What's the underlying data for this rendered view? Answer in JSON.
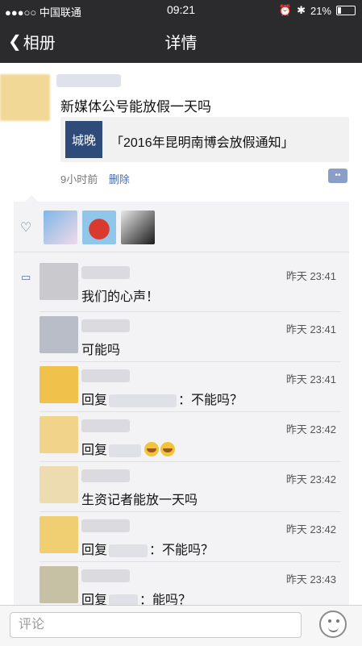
{
  "status": {
    "carrier": "●●●○○ 中国联通",
    "wifi": "wifi-icon",
    "time": "09:21",
    "battery": "21%",
    "battery_icon": "battery-icon"
  },
  "nav": {
    "back": "相册",
    "title": "详情"
  },
  "post": {
    "text": "新媒体公号能放假一天吗",
    "share_title": "「2016年昆明南博会放假通知」",
    "thumb_text": "城晚",
    "time": "9小时前",
    "delete": "删除"
  },
  "comments": [
    {
      "time": "昨天 23:41",
      "text": "我们的心声！"
    },
    {
      "time": "昨天 23:41",
      "text": "可能吗"
    },
    {
      "time": "昨天 23:41",
      "prefix": "回复",
      "suffix": "：不能吗？"
    },
    {
      "time": "昨天 23:42",
      "prefix": "回复",
      "suffix": ""
    },
    {
      "time": "昨天 23:42",
      "text": "生资记者能放一天吗"
    },
    {
      "time": "昨天 23:42",
      "prefix": "回复",
      "suffix": "：不能吗？"
    },
    {
      "time": "昨天 23:43",
      "prefix": "回复",
      "suffix": "：能吗？"
    }
  ],
  "input": {
    "placeholder": "评论"
  },
  "colors": {
    "topbar": "#2b2b2e",
    "link": "#4a6ea9",
    "panel": "#f3f3f5"
  }
}
